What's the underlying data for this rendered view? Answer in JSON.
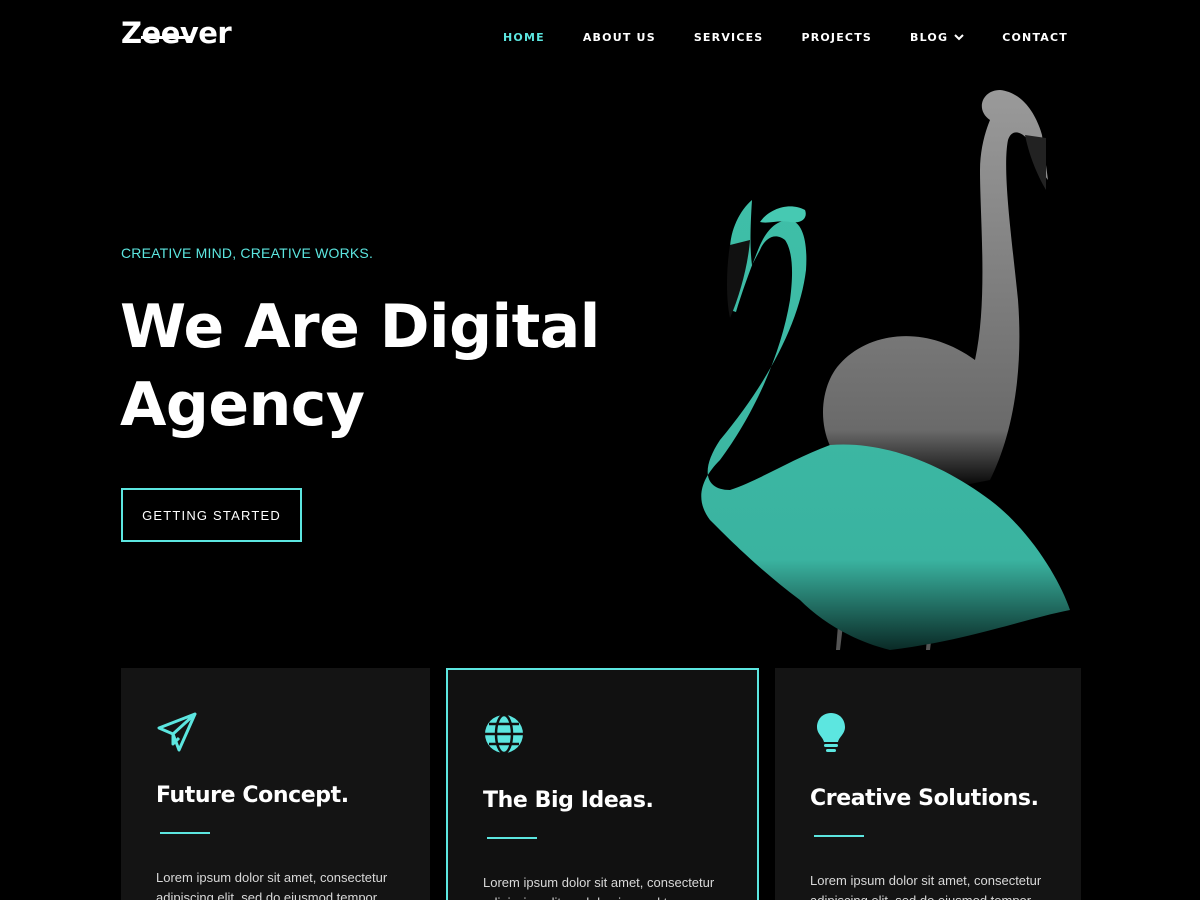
{
  "brand": {
    "logo": "Zeever"
  },
  "nav": {
    "items": [
      {
        "label": "HOME",
        "active": true
      },
      {
        "label": "ABOUT US"
      },
      {
        "label": "SERVICES"
      },
      {
        "label": "PROJECTS"
      },
      {
        "label": "BLOG",
        "has_dropdown": true
      },
      {
        "label": "CONTACT"
      }
    ]
  },
  "hero": {
    "tagline": "CREATIVE MIND, CREATIVE WORKS.",
    "title": "We Are Digital Agency",
    "cta_label": "GETTING STARTED"
  },
  "features": [
    {
      "icon": "paper-plane-icon",
      "title": "Future Concept.",
      "text": "Lorem ipsum dolor sit amet, consectetur adipiscing elit, sed do eiusmod tempor"
    },
    {
      "icon": "globe-icon",
      "title": "The Big Ideas.",
      "text": "Lorem ipsum dolor sit amet, consectetur adipiscing elit, sed do eiusmod tempor"
    },
    {
      "icon": "lightbulb-icon",
      "title": "Creative Solutions.",
      "text": "Lorem ipsum dolor sit amet, consectetur adipiscing elit, sed do eiusmod tempor"
    }
  ],
  "colors": {
    "accent": "#5ce6e0",
    "background": "#000000",
    "card": "#141414"
  }
}
